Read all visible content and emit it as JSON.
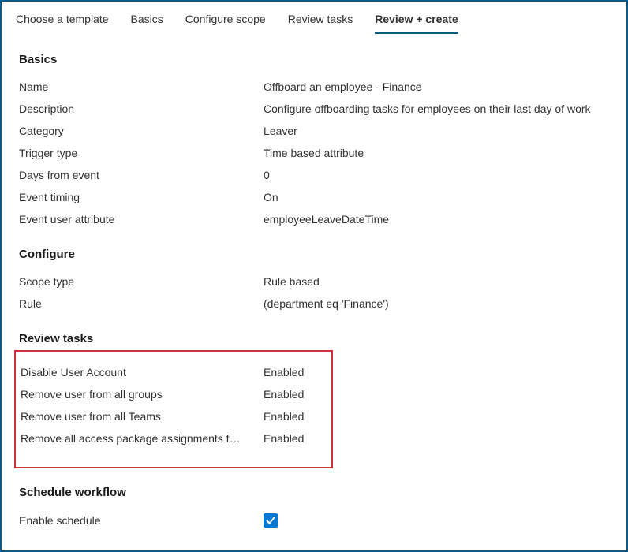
{
  "tabs": {
    "choose_template": "Choose a template",
    "basics": "Basics",
    "configure_scope": "Configure scope",
    "review_tasks": "Review tasks",
    "review_create": "Review + create"
  },
  "sections": {
    "basics": {
      "title": "Basics",
      "rows": {
        "name": {
          "label": "Name",
          "value": "Offboard an employee - Finance"
        },
        "description": {
          "label": "Description",
          "value": "Configure offboarding tasks for employees on their last day of work"
        },
        "category": {
          "label": "Category",
          "value": "Leaver"
        },
        "trigger_type": {
          "label": "Trigger type",
          "value": "Time based attribute"
        },
        "days_from_event": {
          "label": "Days from event",
          "value": "0"
        },
        "event_timing": {
          "label": "Event timing",
          "value": "On"
        },
        "event_user_attribute": {
          "label": "Event user attribute",
          "value": "employeeLeaveDateTime"
        }
      }
    },
    "configure": {
      "title": "Configure",
      "rows": {
        "scope_type": {
          "label": "Scope type",
          "value": "Rule based"
        },
        "rule": {
          "label": "Rule",
          "value": " (department eq 'Finance')"
        }
      }
    },
    "review_tasks": {
      "title": "Review tasks",
      "tasks": [
        {
          "label": "Disable User Account",
          "value": "Enabled"
        },
        {
          "label": "Remove user from all groups",
          "value": "Enabled"
        },
        {
          "label": "Remove user from all Teams",
          "value": "Enabled"
        },
        {
          "label": "Remove all access package assignments for user",
          "value": "Enabled"
        }
      ]
    },
    "schedule_workflow": {
      "title": "Schedule workflow",
      "rows": {
        "enable_schedule": {
          "label": "Enable schedule",
          "checked": true
        }
      }
    }
  }
}
